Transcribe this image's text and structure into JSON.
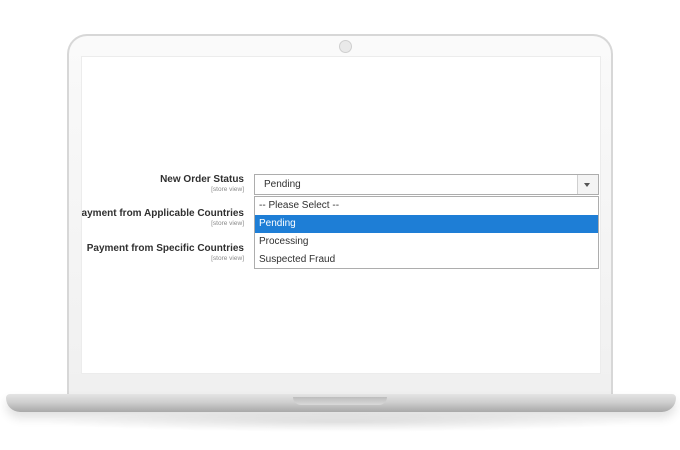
{
  "form": {
    "fields": [
      {
        "label": "New Order Status",
        "scope": "[store view]"
      },
      {
        "label": "Payment from Applicable Countries",
        "scope": "[store view]"
      },
      {
        "label": "Payment from Specific Countries",
        "scope": "[store view]"
      }
    ],
    "order_status_select": {
      "value": "Pending",
      "options": [
        "-- Please Select --",
        "Pending",
        "Processing",
        "Suspected Fraud"
      ],
      "selected_option": "Pending"
    }
  },
  "colors": {
    "selected_option_bg": "#1e7ed6",
    "label_text": "#303030",
    "scope_text": "#8a8a8a"
  }
}
